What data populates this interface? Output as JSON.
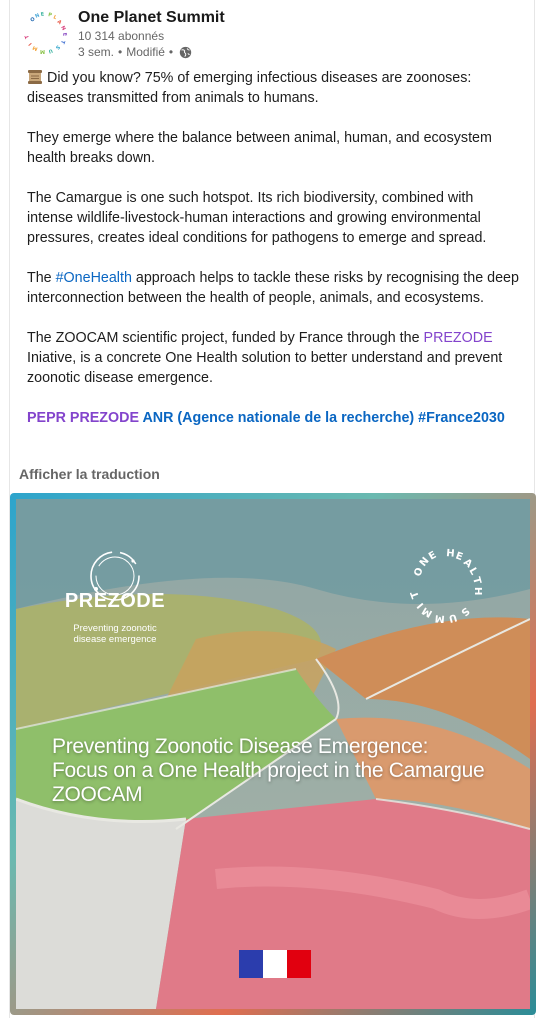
{
  "post": {
    "author": "One Planet Summit",
    "followers": "10 314 abonnés",
    "time": "3 sem.",
    "edited": "Modifié",
    "logo_text": "ONE PLANET SUMMIT",
    "globe_icon": "globe-icon",
    "paragraphs": {
      "p1": "Did you know? 75% of emerging infectious diseases are zoonoses: diseases transmitted from animals to humans.",
      "p2": "They emerge where the balance between animal, human, and ecosystem health breaks down.",
      "p3": "The Camargue is one such hotspot. Its rich biodiversity, combined with intense wildlife-livestock-human interactions and growing environmental pressures, creates ideal conditions for pathogens to emerge and spread.",
      "p4_before": "The ",
      "p4_hashtag": "#OneHealth",
      "p4_after": " approach helps to tackle these risks by recognising the deep interconnection between the health of people, animals, and ecosystems.",
      "p5_before": "The ZOOCAM scientific project, funded by France through the ",
      "p5_mention": "PREZODE",
      "p5_after": " Iniative, is a concrete One Health solution to better understand and prevent zoonotic disease emergence."
    },
    "tags": {
      "t1": "PEPR PREZODE",
      "t2": "ANR (Agence nationale de la recherche)",
      "t3": "#France2030"
    },
    "translate_label": "Afficher la traduction"
  },
  "media": {
    "prezode_name": "PREZODE",
    "prezode_sub1": "Preventing zoonotic",
    "prezode_sub2": "disease emergence",
    "badge_text": "ONE HEALTH SUMMIT",
    "headline1": "Preventing Zoonotic Disease Emergence:",
    "headline2": "Focus on a One Health project in the Camargue",
    "headline3": "ZOOCAM"
  },
  "colors": {
    "link_blue": "#0a66c2",
    "mention_purple": "#8344cc",
    "muted": "#666666"
  }
}
